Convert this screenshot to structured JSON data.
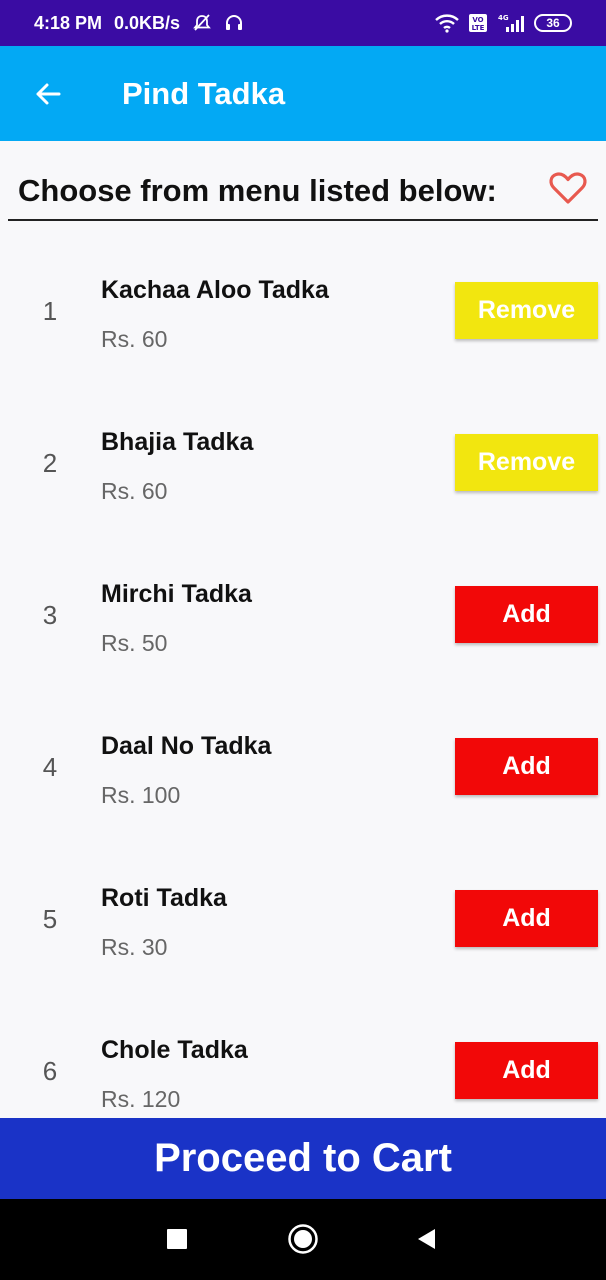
{
  "status_bar": {
    "time": "4:18 PM",
    "network_speed": "0.0KB/s",
    "battery": "36",
    "icons": [
      "mute-icon",
      "headset-icon",
      "wifi-icon",
      "volte-icon",
      "signal-4g-icon",
      "battery-icon"
    ]
  },
  "app_bar": {
    "title": "Pind Tadka",
    "back_icon": "arrow-left-icon"
  },
  "menu": {
    "header": "Choose from menu listed below:",
    "favorite_icon": "heart-outline-icon",
    "items": [
      {
        "index": "1",
        "name": "Kachaa Aloo Tadka",
        "price": "Rs. 60",
        "button": "Remove",
        "state": "remove"
      },
      {
        "index": "2",
        "name": "Bhajia Tadka",
        "price": "Rs. 60",
        "button": "Remove",
        "state": "remove"
      },
      {
        "index": "3",
        "name": "Mirchi Tadka",
        "price": "Rs. 50",
        "button": "Add",
        "state": "add"
      },
      {
        "index": "4",
        "name": "Daal No Tadka",
        "price": "Rs. 100",
        "button": "Add",
        "state": "add"
      },
      {
        "index": "5",
        "name": "Roti Tadka",
        "price": "Rs. 30",
        "button": "Add",
        "state": "add"
      },
      {
        "index": "6",
        "name": "Chole Tadka",
        "price": "Rs. 120",
        "button": "Add",
        "state": "add"
      }
    ]
  },
  "cart": {
    "label": "Proceed to Cart"
  },
  "nav_bar": {
    "icons": [
      "recents-square-icon",
      "home-circle-icon",
      "back-triangle-icon"
    ]
  },
  "colors": {
    "status_bar": "#3a0ca3",
    "app_bar": "#03a9f4",
    "remove_button": "#f2e60f",
    "add_button": "#f20808",
    "cart_bar": "#1a33c7",
    "heart": "#e8594f"
  }
}
